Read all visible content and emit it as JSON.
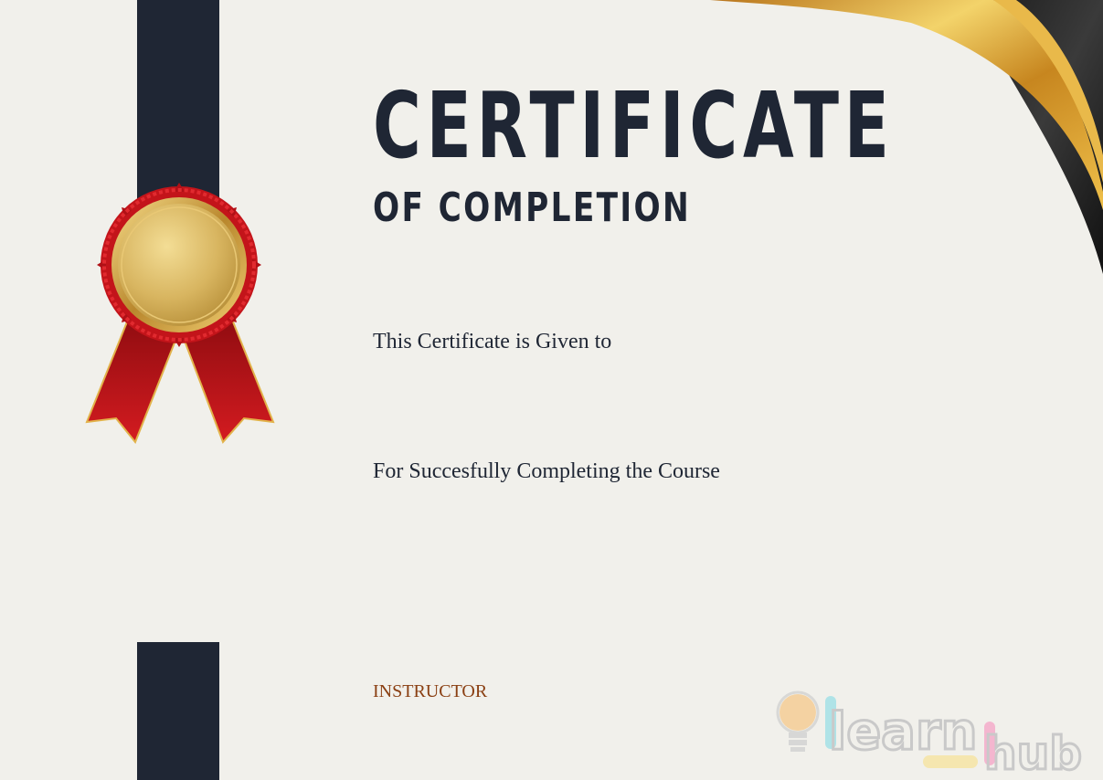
{
  "certificate": {
    "title": "CERTIFICATE",
    "subtitle": "OF COMPLETION",
    "given_to_label": "This Certificate is Given to",
    "completion_label": "For Succesfully Completing the Course",
    "instructor_label": "INSTRUCTOR"
  },
  "logo": {
    "icon": "lightbulb-icon",
    "text_primary": "learn",
    "text_secondary": "hub"
  },
  "colors": {
    "background": "#f1f0eb",
    "navy": "#1f2634",
    "gold": "#d9a531",
    "ribbon_red": "#c0141b",
    "instructor_text": "#8a3f12"
  }
}
